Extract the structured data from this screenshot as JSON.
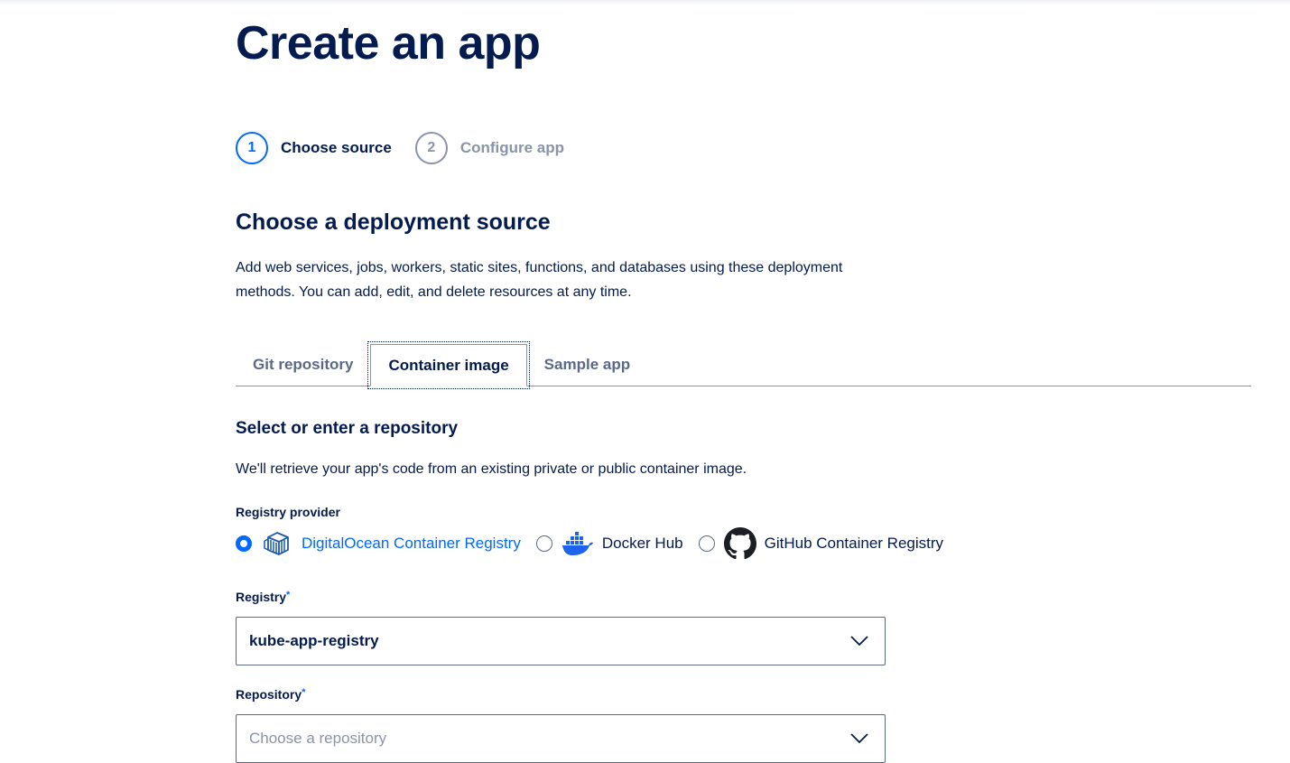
{
  "page_title": "Create an app",
  "stepper": {
    "steps": [
      {
        "number": "1",
        "label": "Choose source",
        "state": "active"
      },
      {
        "number": "2",
        "label": "Configure app",
        "state": "inactive"
      }
    ]
  },
  "section": {
    "heading": "Choose a deployment source",
    "description": "Add web services, jobs, workers, static sites, functions, and databases using these deployment methods. You can add, edit, and delete resources at any time."
  },
  "tabs": [
    {
      "label": "Git repository",
      "selected": false
    },
    {
      "label": "Container image",
      "selected": true
    },
    {
      "label": "Sample app",
      "selected": false
    }
  ],
  "container": {
    "heading": "Select or enter a repository",
    "description": "We'll retrieve your app's code from an existing private or public container image.",
    "provider_label": "Registry provider",
    "providers": [
      {
        "label": "DigitalOcean Container Registry",
        "icon": "digitalocean-registry-icon",
        "selected": true
      },
      {
        "label": "Docker Hub",
        "icon": "docker-icon",
        "selected": false
      },
      {
        "label": "GitHub Container Registry",
        "icon": "github-icon",
        "selected": false
      }
    ],
    "registry_label": "Registry",
    "registry_required": "*",
    "registry_value": "kube-app-registry",
    "repository_label": "Repository",
    "repository_required": "*",
    "repository_placeholder": "Choose a repository"
  },
  "colors": {
    "primary": "#0069ff",
    "text": "#031b4e",
    "muted": "#8a93a8",
    "tab_text": "#5b6987"
  }
}
